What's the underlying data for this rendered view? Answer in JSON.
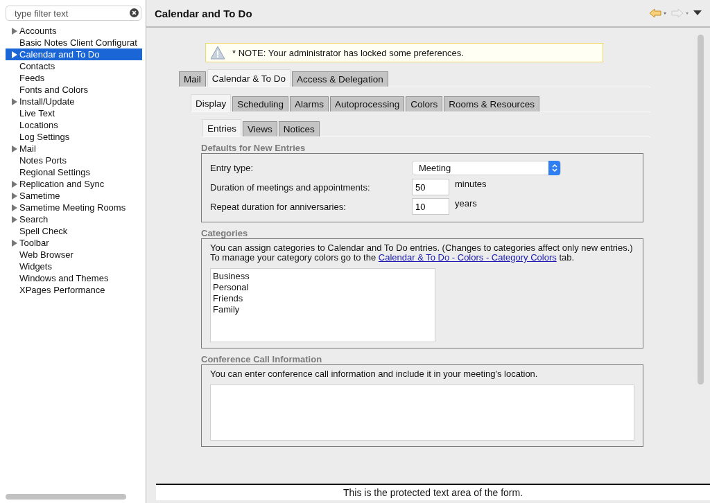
{
  "filter": {
    "placeholder": "type filter text"
  },
  "tree": [
    {
      "label": "Accounts",
      "expandable": true,
      "selected": false
    },
    {
      "label": "Basic Notes Client Configurat",
      "expandable": false,
      "selected": false
    },
    {
      "label": "Calendar and To Do",
      "expandable": true,
      "selected": true
    },
    {
      "label": "Contacts",
      "expandable": false,
      "selected": false
    },
    {
      "label": "Feeds",
      "expandable": false,
      "selected": false
    },
    {
      "label": "Fonts and Colors",
      "expandable": false,
      "selected": false
    },
    {
      "label": "Install/Update",
      "expandable": true,
      "selected": false
    },
    {
      "label": "Live Text",
      "expandable": false,
      "selected": false
    },
    {
      "label": "Locations",
      "expandable": false,
      "selected": false
    },
    {
      "label": "Log Settings",
      "expandable": false,
      "selected": false
    },
    {
      "label": "Mail",
      "expandable": true,
      "selected": false
    },
    {
      "label": "Notes Ports",
      "expandable": false,
      "selected": false
    },
    {
      "label": "Regional Settings",
      "expandable": false,
      "selected": false
    },
    {
      "label": "Replication and Sync",
      "expandable": true,
      "selected": false
    },
    {
      "label": "Sametime",
      "expandable": true,
      "selected": false
    },
    {
      "label": "Sametime Meeting Rooms",
      "expandable": true,
      "selected": false
    },
    {
      "label": "Search",
      "expandable": true,
      "selected": false
    },
    {
      "label": "Spell Check",
      "expandable": false,
      "selected": false
    },
    {
      "label": "Toolbar",
      "expandable": true,
      "selected": false
    },
    {
      "label": "Web Browser",
      "expandable": false,
      "selected": false
    },
    {
      "label": "Widgets",
      "expandable": false,
      "selected": false
    },
    {
      "label": "Windows and Themes",
      "expandable": false,
      "selected": false
    },
    {
      "label": "XPages Performance",
      "expandable": false,
      "selected": false
    }
  ],
  "page_title": "Calendar and To Do",
  "note": "* NOTE: Your administrator has locked some preferences.",
  "tab_rows": [
    [
      {
        "label": "Mail",
        "selected": false
      },
      {
        "label": "Calendar & To Do",
        "selected": true
      },
      {
        "label": "Access & Delegation",
        "selected": false
      }
    ],
    [
      {
        "label": "Display",
        "selected": true
      },
      {
        "label": "Scheduling",
        "selected": false
      },
      {
        "label": "Alarms",
        "selected": false
      },
      {
        "label": "Autoprocessing",
        "selected": false
      },
      {
        "label": "Colors",
        "selected": false
      },
      {
        "label": "Rooms & Resources",
        "selected": false
      }
    ],
    [
      {
        "label": "Entries",
        "selected": true
      },
      {
        "label": "Views",
        "selected": false
      },
      {
        "label": "Notices",
        "selected": false
      }
    ]
  ],
  "defaults": {
    "heading": "Defaults for New Entries",
    "entry_type": {
      "label": "Entry type:",
      "value": "Meeting"
    },
    "fields": [
      {
        "label": "Duration of meetings and appointments:",
        "value": "50",
        "unit": "minutes"
      },
      {
        "label": "Repeat duration for anniversaries:",
        "value": "10",
        "unit": "years"
      }
    ]
  },
  "categories": {
    "heading": "Categories",
    "text_before": "You can assign categories to Calendar and To Do entries.  (Changes to categories affect only new entries.) To manage your category colors go to the",
    "link": "Calendar & To Do - Colors - Category Colors",
    "text_after": "tab.",
    "items": [
      "Business",
      "Personal",
      "Friends",
      "Family"
    ]
  },
  "conference": {
    "heading": "Conference Call Information",
    "text": "You can enter conference call information and include it in your meeting's location."
  },
  "footer": "This is the protected text area of the form."
}
